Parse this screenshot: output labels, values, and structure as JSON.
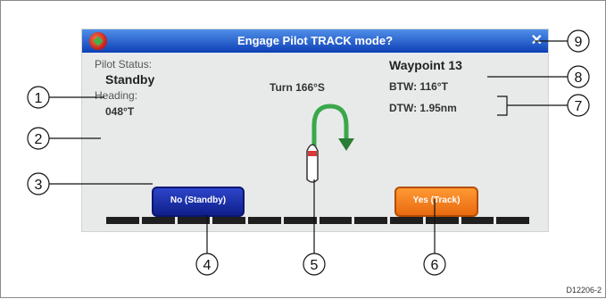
{
  "dialog": {
    "title": "Engage Pilot TRACK mode?",
    "close_glyph": "✕",
    "pilot_status_label": "Pilot Status:",
    "pilot_status_value": "Standby",
    "heading_label": "Heading:",
    "heading_value": "048°T",
    "turn_text": "Turn 166°S",
    "waypoint": "Waypoint 13",
    "btw": "BTW: 116°T",
    "dtw": "DTW: 1.95nm",
    "no_button": "No (Standby)",
    "yes_button": "Yes (Track)",
    "progress_segments": 12
  },
  "callouts": [
    "1",
    "2",
    "3",
    "4",
    "5",
    "6",
    "7",
    "8",
    "9"
  ],
  "figure_code": "D12206-2",
  "icons": [
    "app-logo-icon",
    "close-icon",
    "u-turn-arrow-icon",
    "boat-icon"
  ],
  "colors": {
    "titlebar": "#1f55cc",
    "no_button": "#1a2fa8",
    "yes_button": "#f47a1c",
    "arrow": "#3aa84a"
  }
}
